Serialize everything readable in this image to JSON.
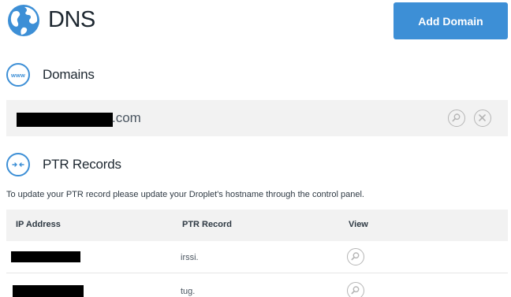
{
  "header": {
    "title": "DNS",
    "add_domain_label": "Add Domain",
    "icon": "globe-icon"
  },
  "domains_section": {
    "title": "Domains",
    "icon_text": "www",
    "domains": [
      {
        "name_suffix": ".com",
        "name_redacted": true
      }
    ]
  },
  "ptr_section": {
    "title": "PTR Records",
    "icon": "arrows-in-icon",
    "info": "To update your PTR record please update your Droplet's hostname through the control panel.",
    "columns": [
      "IP Address",
      "PTR Record",
      "View"
    ],
    "rows": [
      {
        "ip_redacted": true,
        "ptr": "irssi."
      },
      {
        "ip_redacted": true,
        "ptr": "tug."
      }
    ]
  },
  "colors": {
    "accent": "#3d8fd6",
    "row_bg": "#f2f2f2",
    "text": "#2f3a44"
  }
}
